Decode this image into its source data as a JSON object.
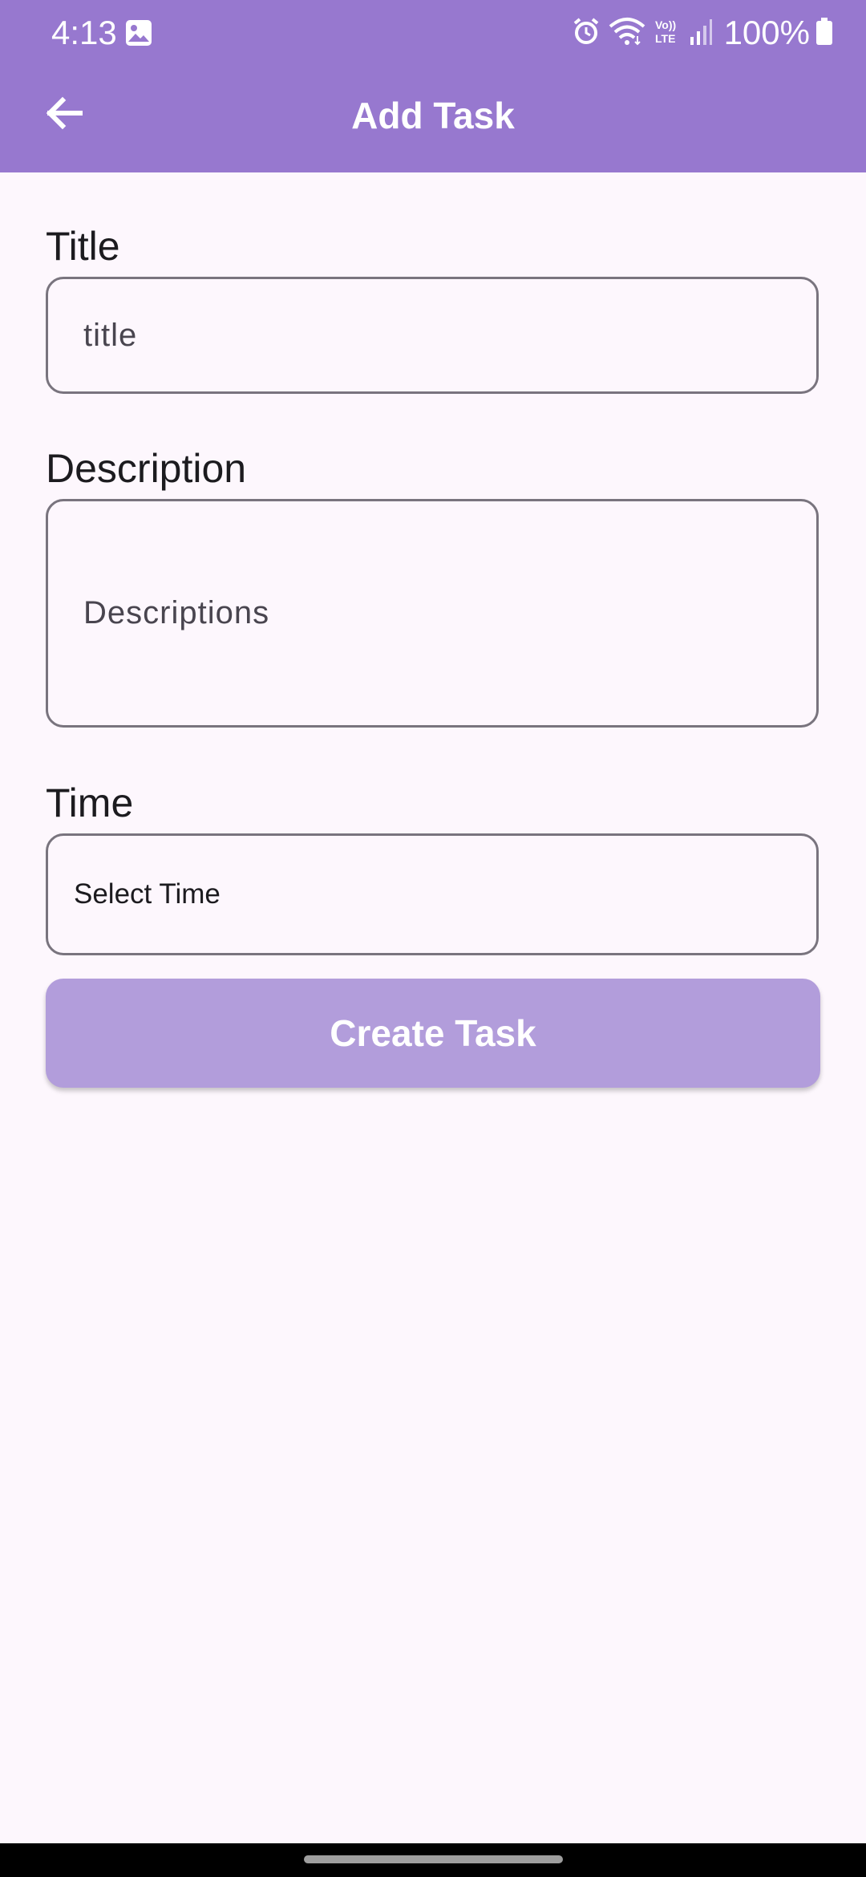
{
  "status_bar": {
    "time": "4:13",
    "battery": "100%",
    "icons": [
      "gallery-icon",
      "alarm-icon",
      "wifi-icon",
      "volte-icon",
      "signal-icon",
      "battery-icon"
    ]
  },
  "header": {
    "title": "Add Task",
    "back_icon": "arrow-left-icon",
    "background": "#9778cf"
  },
  "form": {
    "title_label": "Title",
    "title_placeholder": "title",
    "description_label": "Description",
    "description_placeholder": "Descriptions",
    "time_label": "Time",
    "time_value": "Select Time",
    "submit_label": "Create Task",
    "submit_color": "#b29ddb"
  }
}
